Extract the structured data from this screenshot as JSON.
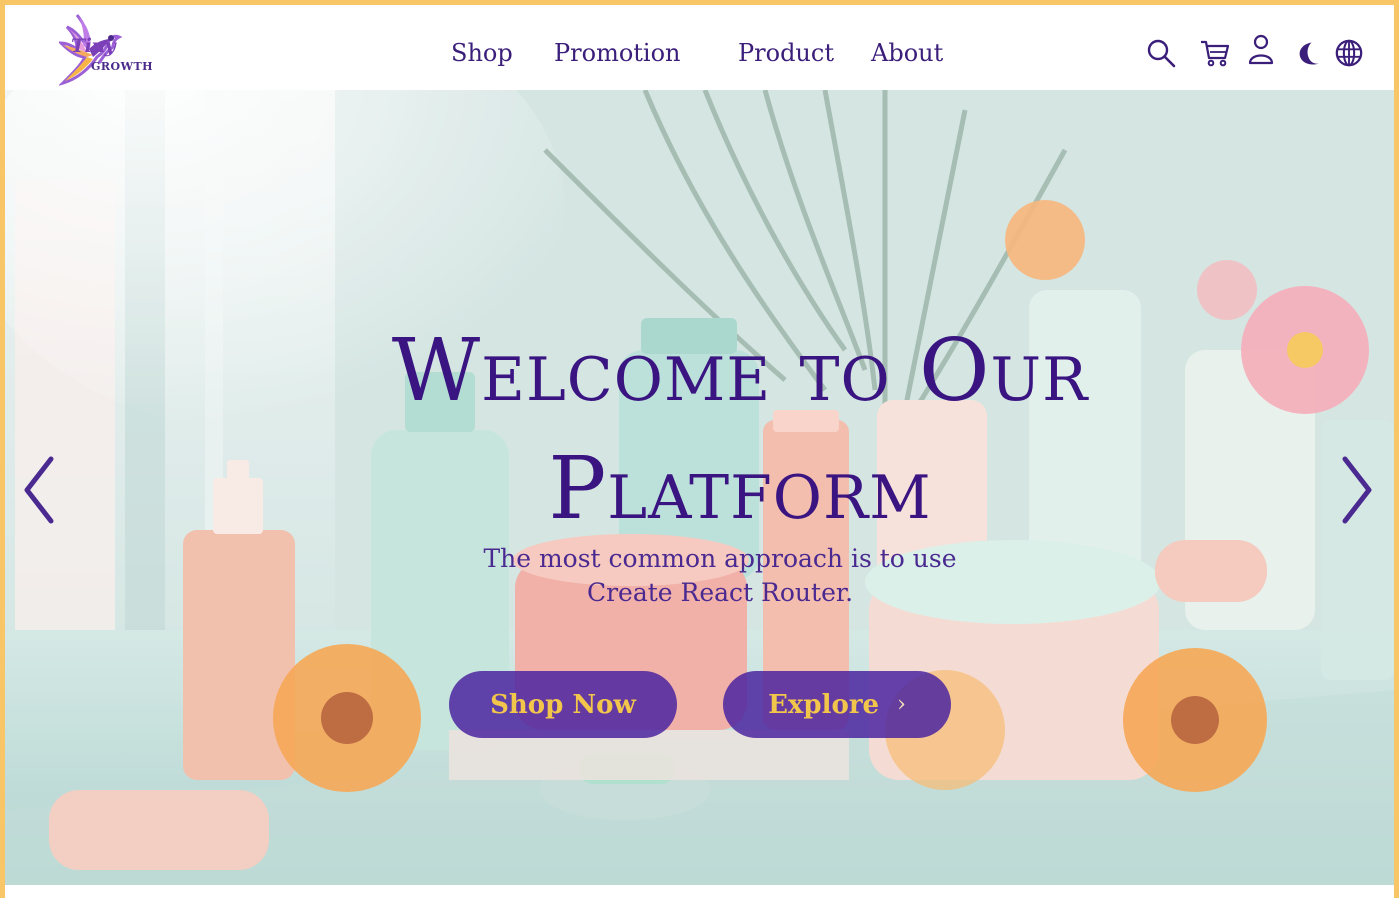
{
  "brand": {
    "line1": "Tiny",
    "line2": "GROWTH",
    "colors": {
      "primary": "#3a1582",
      "accent": "#f2c64a",
      "frame": "#f9c667"
    }
  },
  "nav": {
    "links": [
      {
        "label": "Shop"
      },
      {
        "label": "Promotion"
      },
      {
        "label": "Product"
      },
      {
        "label": "About"
      }
    ],
    "icons": [
      "search-icon",
      "cart-icon",
      "user-icon",
      "moon-icon",
      "globe-icon"
    ]
  },
  "hero": {
    "title_line1": "Welcome to Our",
    "title_line2": "Platform",
    "subtitle_line1": "The most common approach is to use",
    "subtitle_line2": "Create React Router.",
    "primary_button": "Shop Now",
    "secondary_button": "Explore",
    "secondary_chevron": "›"
  }
}
